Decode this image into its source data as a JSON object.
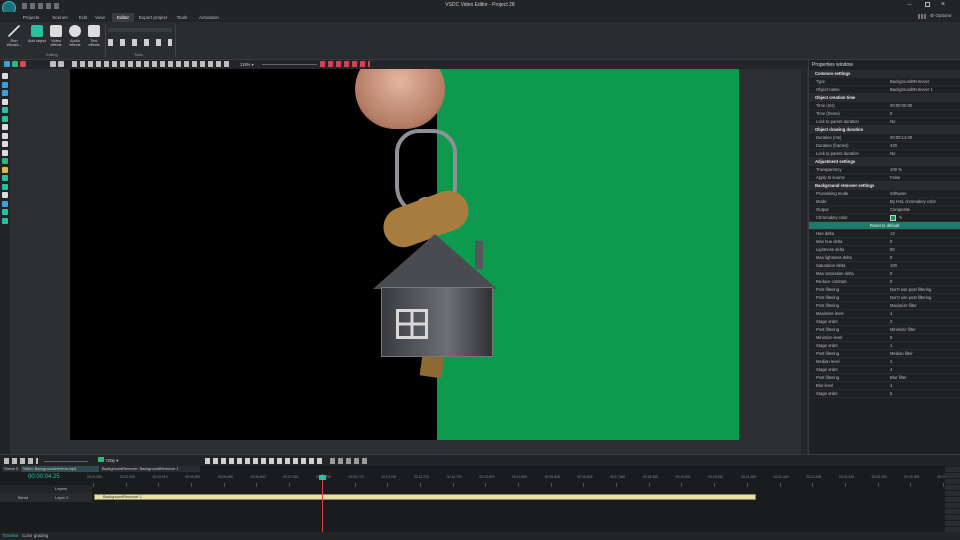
{
  "app": {
    "title": "VSDC Video Editor - Project 28",
    "options_label": "Options"
  },
  "menu": {
    "tabs": [
      "Projects",
      "Scenes",
      "Edit",
      "View",
      "Editor",
      "Export project",
      "Tools",
      "Activation"
    ],
    "active": "Editor"
  },
  "ribbon": {
    "buttons": [
      {
        "label": "Run Wizard..."
      },
      {
        "label": "Add object"
      },
      {
        "label": "Video effects"
      },
      {
        "label": "Audio effects"
      },
      {
        "label": "Text effects"
      }
    ],
    "groups": {
      "editing": "Editing",
      "tools": "Tools"
    }
  },
  "preview": {
    "zoom": "118%",
    "quality": "720p"
  },
  "properties": {
    "title": "Properties window",
    "rows": [
      {
        "type": "section",
        "name": "Common settings"
      },
      {
        "name": "Type",
        "value": "BackgroundRemover"
      },
      {
        "name": "Object name",
        "value": "BackgroundRemover 1"
      },
      {
        "type": "section",
        "name": "Object creation time"
      },
      {
        "name": "Time (ms)",
        "value": "00:00:00.00"
      },
      {
        "name": "Time (frame)",
        "value": "0"
      },
      {
        "name": "Lock to parent duration",
        "value": "No"
      },
      {
        "type": "section",
        "name": "Object drawing duration"
      },
      {
        "name": "Duration (ms)",
        "value": "00:00:14.00"
      },
      {
        "name": "Duration (frames)",
        "value": "420"
      },
      {
        "name": "Lock to parent duration",
        "value": "No"
      },
      {
        "type": "section",
        "name": "Adjustment settings"
      },
      {
        "name": "Transparency",
        "value": "100 %"
      },
      {
        "name": "Apply to source",
        "value": "False"
      },
      {
        "type": "section",
        "name": "Background remover settings"
      },
      {
        "name": "Processing mode",
        "value": "Software"
      },
      {
        "name": "Mode",
        "value": "By HSL chromakey color"
      },
      {
        "name": "Output",
        "value": "Composite"
      },
      {
        "name": "Chromakey color",
        "value": ""
      },
      {
        "type": "button",
        "name": "Reset to default"
      },
      {
        "name": "Hue delta",
        "value": "13"
      },
      {
        "name": "Max hue delta",
        "value": "0"
      },
      {
        "name": "Lightness delta",
        "value": "50"
      },
      {
        "name": "Max lightness delta",
        "value": "0"
      },
      {
        "name": "Saturation delta",
        "value": "100"
      },
      {
        "name": "Max saturation delta",
        "value": "0"
      },
      {
        "name": "Reduce contrast",
        "value": "0"
      },
      {
        "name": "Post filtering",
        "value": "Don't use post filtering"
      },
      {
        "name": "Post filtering",
        "value": "Don't use post filtering"
      },
      {
        "name": "Post filtering",
        "value": "Maximize filter"
      },
      {
        "name": "Maximize level",
        "value": "4"
      },
      {
        "name": "Stage order",
        "value": "2"
      },
      {
        "name": "Post filtering",
        "value": "Minimize filter"
      },
      {
        "name": "Minimize level",
        "value": "8"
      },
      {
        "name": "Stage order",
        "value": "1"
      },
      {
        "name": "Post filtering",
        "value": "Median filter"
      },
      {
        "name": "Median level",
        "value": "2"
      },
      {
        "name": "Stage order",
        "value": "4"
      },
      {
        "name": "Post filtering",
        "value": "Blur filter"
      },
      {
        "name": "Blur level",
        "value": "4"
      },
      {
        "name": "Stage order",
        "value": "5"
      }
    ]
  },
  "timeline": {
    "tabs": [
      "Scene 0",
      "Video: Backgroundchroma.mp4",
      "BackgroundRemover: BackgroundRemover 1"
    ],
    "timecode": "00:00:04.25",
    "layers_label": "Layers",
    "track": {
      "blend": "Blend",
      "layer": "Layer 2",
      "clip": "BackgroundRemover 1"
    },
    "ruler": [
      "00:01.960",
      "00:02.935",
      "00:03.910",
      "00:04.890",
      "00:05.865",
      "00:06.840",
      "00:07.815",
      "00:08.795",
      "00:09.770",
      "00:10.745",
      "00:11.720",
      "00:12.700",
      "00:13.675",
      "00:14.650",
      "00:15.625",
      "00:16.605",
      "00:17.580",
      "00:18.555",
      "00:19.530",
      "00:20.510",
      "00:21.485",
      "00:22.460",
      "00:23.435",
      "00:24.415",
      "00:25.390",
      "00:26.365",
      "00:27.340"
    ]
  },
  "statusbar": {
    "tabs": [
      "Timeline",
      "Color grading"
    ]
  },
  "colors": {
    "accent": "#27c3a8",
    "chroma": "#0d9a4f"
  }
}
